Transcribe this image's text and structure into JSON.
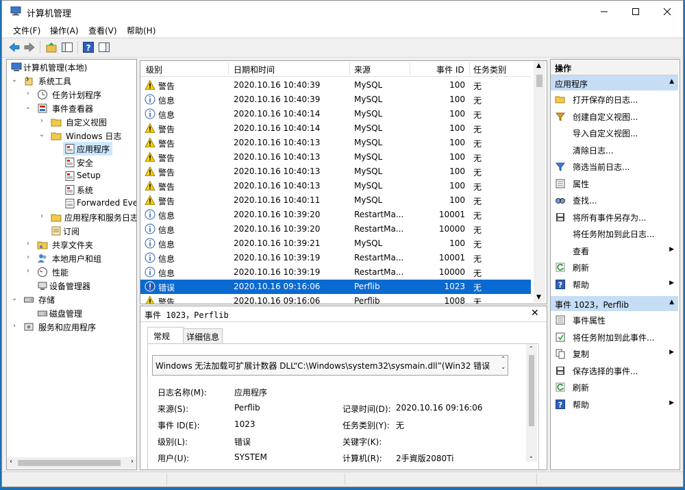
{
  "window": {
    "title": "计算机管理"
  },
  "menu": [
    {
      "label": "文件(F)"
    },
    {
      "label": "操作(A)"
    },
    {
      "label": "查看(V)"
    },
    {
      "label": "帮助(H)"
    }
  ],
  "tree": [
    {
      "label": "计算机管理(本地)"
    },
    {
      "label": "系统工具"
    },
    {
      "label": "任务计划程序"
    },
    {
      "label": "事件查看器"
    },
    {
      "label": "自定义视图"
    },
    {
      "label": "Windows 日志"
    },
    {
      "label": "应用程序"
    },
    {
      "label": "安全"
    },
    {
      "label": "Setup"
    },
    {
      "label": "系统"
    },
    {
      "label": "Forwarded Eve"
    },
    {
      "label": "应用程序和服务日志"
    },
    {
      "label": "订阅"
    },
    {
      "label": "共享文件夹"
    },
    {
      "label": "本地用户和组"
    },
    {
      "label": "性能"
    },
    {
      "label": "设备管理器"
    },
    {
      "label": "存储"
    },
    {
      "label": "磁盘管理"
    },
    {
      "label": "服务和应用程序"
    }
  ],
  "events": {
    "columns": [
      "级别",
      "日期和时间",
      "来源",
      "事件 ID",
      "任务类别"
    ],
    "rows": [
      {
        "level": "警告",
        "time": "2020.10.16 10:40:39",
        "source": "MySQL",
        "id": "100",
        "cat": "无"
      },
      {
        "level": "信息",
        "time": "2020.10.16 10:40:39",
        "source": "MySQL",
        "id": "100",
        "cat": "无"
      },
      {
        "level": "信息",
        "time": "2020.10.16 10:40:14",
        "source": "MySQL",
        "id": "100",
        "cat": "无"
      },
      {
        "level": "警告",
        "time": "2020.10.16 10:40:14",
        "source": "MySQL",
        "id": "100",
        "cat": "无"
      },
      {
        "level": "警告",
        "time": "2020.10.16 10:40:13",
        "source": "MySQL",
        "id": "100",
        "cat": "无"
      },
      {
        "level": "警告",
        "time": "2020.10.16 10:40:13",
        "source": "MySQL",
        "id": "100",
        "cat": "无"
      },
      {
        "level": "警告",
        "time": "2020.10.16 10:40:13",
        "source": "MySQL",
        "id": "100",
        "cat": "无"
      },
      {
        "level": "警告",
        "time": "2020.10.16 10:40:13",
        "source": "MySQL",
        "id": "100",
        "cat": "无"
      },
      {
        "level": "警告",
        "time": "2020.10.16 10:40:11",
        "source": "MySQL",
        "id": "100",
        "cat": "无"
      },
      {
        "level": "信息",
        "time": "2020.10.16 10:39:20",
        "source": "RestartMa...",
        "id": "10001",
        "cat": "无"
      },
      {
        "level": "信息",
        "time": "2020.10.16 10:39:20",
        "source": "RestartMa...",
        "id": "10000",
        "cat": "无"
      },
      {
        "level": "信息",
        "time": "2020.10.16 10:39:21",
        "source": "MySQL",
        "id": "100",
        "cat": "无"
      },
      {
        "level": "信息",
        "time": "2020.10.16 10:39:19",
        "source": "RestartMa...",
        "id": "10001",
        "cat": "无"
      },
      {
        "level": "信息",
        "time": "2020.10.16 10:39:19",
        "source": "RestartMa...",
        "id": "10000",
        "cat": "无"
      },
      {
        "level": "错误",
        "time": "2020.10.16 09:16:06",
        "source": "Perflib",
        "id": "1023",
        "cat": "无"
      },
      {
        "level": "警告",
        "time": "2020.10.16 09:16:06",
        "source": "Perflib",
        "id": "1008",
        "cat": "无"
      }
    ]
  },
  "detail": {
    "header": "事件 1023，Perflib",
    "tabs": [
      "常规",
      "详细信息"
    ],
    "message": "Windows 无法加载可扩展计数器 DLL“C:\\Windows\\system32\\sysmain.dll”(Win32 错误",
    "fields": {
      "log_name_label": "日志名称(M):",
      "log_name": "应用程序",
      "source_label": "来源(S):",
      "source": "Perflib",
      "recorded_label": "记录时间(D):",
      "recorded": "2020.10.16 09:16:06",
      "event_id_label": "事件 ID(E):",
      "event_id": "1023",
      "task_cat_label": "任务类别(Y):",
      "task_cat": "无",
      "level_label": "级别(L):",
      "level": "错误",
      "keywords_label": "关键字(K):",
      "keywords": "",
      "user_label": "用户(U):",
      "user": "SYSTEM",
      "computer_label": "计算机(R):",
      "computer": "2手資版2080Ti"
    }
  },
  "actions": {
    "title": "操作",
    "section1": "应用程序",
    "items1": [
      {
        "label": "打开保存的日志..."
      },
      {
        "label": "创建自定义视图..."
      },
      {
        "label": "导入自定义视图..."
      },
      {
        "label": "清除日志..."
      },
      {
        "label": "筛选当前日志..."
      },
      {
        "label": "属性"
      },
      {
        "label": "查找..."
      },
      {
        "label": "将所有事件另存为..."
      },
      {
        "label": "将任务附加到此日志..."
      },
      {
        "label": "查看"
      },
      {
        "label": "刷新"
      },
      {
        "label": "帮助"
      }
    ],
    "section2": "事件 1023，Perflib",
    "items2": [
      {
        "label": "事件属性"
      },
      {
        "label": "将任务附加到此事件..."
      },
      {
        "label": "复制"
      },
      {
        "label": "保存选择的事件..."
      },
      {
        "label": "刷新"
      },
      {
        "label": "帮助"
      }
    ]
  },
  "colors": {
    "selection": "#0a6ad1",
    "tree_selection": "#cce8ff",
    "section_header": "#c5ddf5"
  }
}
